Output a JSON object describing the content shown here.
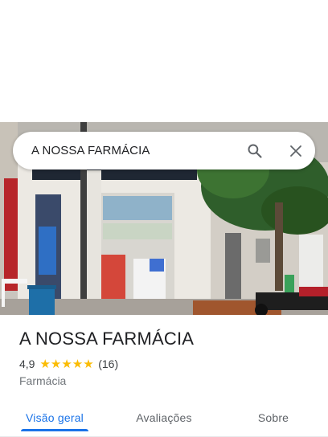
{
  "search": {
    "query": "A NOSSA FARMÁCIA"
  },
  "icons": {
    "search": "search-icon",
    "close": "close-icon",
    "star": "star-icon"
  },
  "place": {
    "name": "A NOSSA FARMÁCIA",
    "rating": "4,9",
    "stars": "★★★★★",
    "review_count": "(16)",
    "category": "Farmácia",
    "photo_description": "Storefront photo of the pharmacy with white facade, open doorway and shelves inside"
  },
  "tabs": [
    {
      "label": "Visão geral",
      "active": true
    },
    {
      "label": "Avaliações",
      "active": false
    },
    {
      "label": "Sobre",
      "active": false
    }
  ],
  "colors": {
    "accent": "#1a73e8",
    "star": "#fbbc04",
    "text": "#202124",
    "secondary": "#70757a"
  }
}
